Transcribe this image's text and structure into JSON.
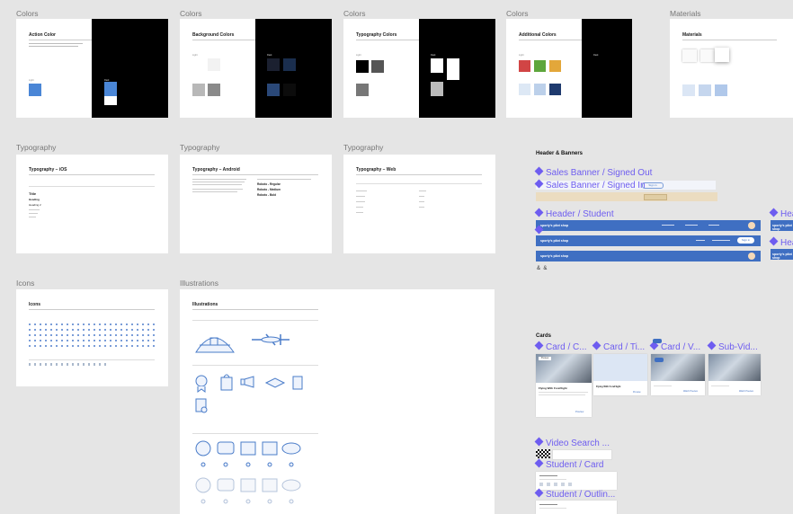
{
  "labels": {
    "colors1": "Colors",
    "colors2": "Colors",
    "colors3": "Colors",
    "colors4": "Colors",
    "materials": "Materials",
    "typo1": "Typography",
    "typo2": "Typography",
    "typo3": "Typography",
    "icons": "Icons",
    "illustrations": "Illustrations"
  },
  "frames": {
    "action_color": "Action Color",
    "background_colors": "Background Colors",
    "typography_colors": "Typography Colors",
    "additional_colors": "Additional Colors",
    "materials": "Materials",
    "typo_ios": "Typography – iOS",
    "typo_android": "Typography – Android",
    "typo_web": "Typography – Web",
    "icons": "Icons",
    "illustrations": "Illustrations"
  },
  "small": {
    "light": "Light",
    "dark": "Dark",
    "title": "Title",
    "heading": "Heading",
    "heading2": "Heading 2",
    "roboto_regular": "Roboto - Regular",
    "roboto_medium": "Roboto - Medium",
    "roboto_bold": "Roboto - Bold"
  },
  "header_banners": {
    "section": "Header & Banners",
    "sales_out": "Sales Banner / Signed Out",
    "sales_in": "Sales Banner / Signed In",
    "header_student": "Header / Student",
    "header_right1": "Hea",
    "header_right2": "Hea",
    "signin": "Sign in",
    "logo": "sporty's pilot shop"
  },
  "cards": {
    "section": "Cards",
    "card1": "Card / C...",
    "card2": "Card / Ti...",
    "card3": "Card / V...",
    "card4": "Sub-Vid...",
    "video_search": "Video Search ...",
    "student_card": "Student / Card",
    "student_outline": "Student / Outlin...",
    "flying_title": "Flying With ForeFlight",
    "preview": "Preview",
    "watch_preview": "Watch Preview"
  },
  "colors": {
    "canvas": "#e5e5e5",
    "accent": "#6e5df0",
    "action_blue": "#4a86d6",
    "header_blue": "#3f6fc2",
    "banner_tan": "#ebdcc0"
  }
}
